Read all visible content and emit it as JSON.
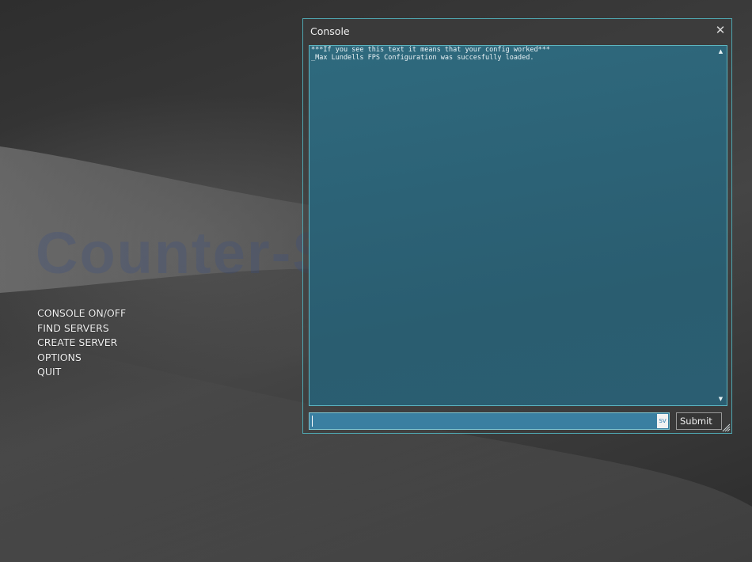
{
  "background": {
    "watermark_text": "Counter-Strike"
  },
  "main_menu": {
    "items": [
      {
        "label": "CONSOLE ON/OFF"
      },
      {
        "label": "FIND SERVERS"
      },
      {
        "label": "CREATE SERVER"
      },
      {
        "label": "OPTIONS"
      },
      {
        "label": "QUIT"
      }
    ]
  },
  "console": {
    "title": "Console",
    "close_glyph": "✕",
    "log_lines": [
      "***If you see this text it means that your config worked***",
      "_Max Lundells FPS Configuration was succesfully loaded."
    ],
    "scroll_up_glyph": "▲",
    "scroll_down_glyph": "▼",
    "input": {
      "value": "",
      "placeholder": "",
      "lang_indicator": "SV"
    },
    "submit_label": "Submit"
  },
  "colors": {
    "accent_border": "#4fa6b0",
    "console_background": "#2c6276",
    "input_background": "#3a7fa1"
  },
  "icons": {
    "close": "close-icon",
    "scroll_up": "scroll-up-arrow-icon",
    "scroll_down": "scroll-down-arrow-icon",
    "resize": "resize-grip-icon"
  }
}
